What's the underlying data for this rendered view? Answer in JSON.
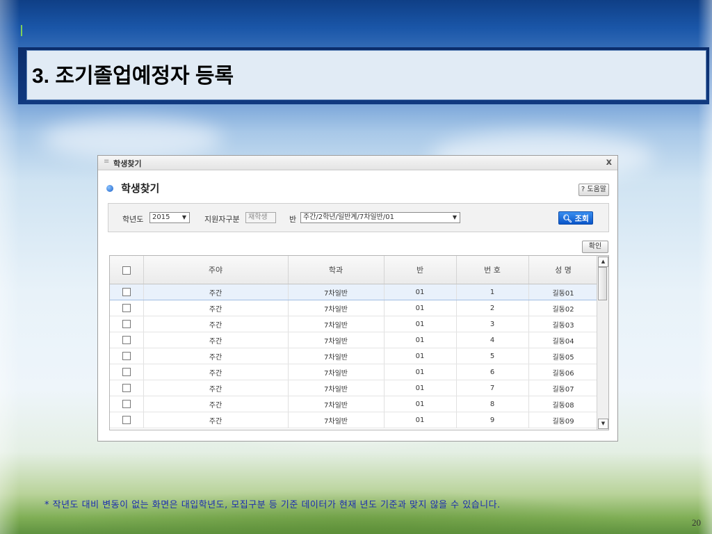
{
  "slide": {
    "title": "3. 조기졸업예정자 등록",
    "note": "* 작년도 대비 변동이 없는 화면은 대입학년도, 모집구분 등 기준 데이터가 현재 년도 기준과 맞지 않을 수 있습니다.",
    "page_number": "20"
  },
  "popup": {
    "window_title": "학생찾기",
    "close_glyph": "x",
    "heading": "학생찾기",
    "help_label": "? 도움말",
    "search": {
      "year_label": "학년도",
      "year_value": "2015",
      "category_label": "지원자구분",
      "category_value": "재학생",
      "class_label": "반",
      "class_value": "주간/2학년/일반계/7차일반/01",
      "search_button": "조회"
    },
    "confirm_button": "확인",
    "table": {
      "headers": [
        "주야",
        "학과",
        "반",
        "번 호",
        "성 명"
      ],
      "rows": [
        [
          "주간",
          "7차일반",
          "01",
          "1",
          "길동01"
        ],
        [
          "주간",
          "7차일반",
          "01",
          "2",
          "길동02"
        ],
        [
          "주간",
          "7차일반",
          "01",
          "3",
          "길동03"
        ],
        [
          "주간",
          "7차일반",
          "01",
          "4",
          "길동04"
        ],
        [
          "주간",
          "7차일반",
          "01",
          "5",
          "길동05"
        ],
        [
          "주간",
          "7차일반",
          "01",
          "6",
          "길동06"
        ],
        [
          "주간",
          "7차일반",
          "01",
          "7",
          "길동07"
        ],
        [
          "주간",
          "7차일반",
          "01",
          "8",
          "길동08"
        ],
        [
          "주간",
          "7차일반",
          "01",
          "9",
          "길동09"
        ]
      ]
    }
  }
}
